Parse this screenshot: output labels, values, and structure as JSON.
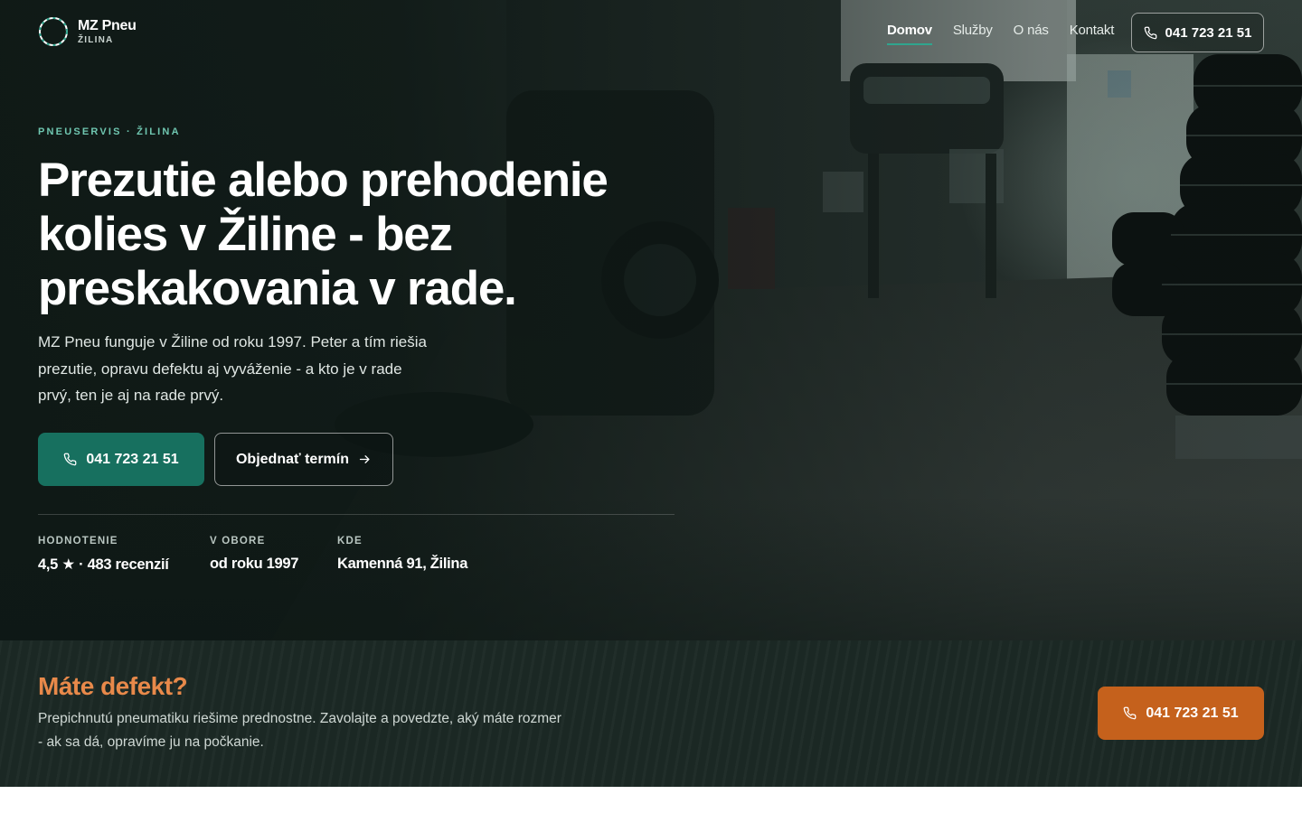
{
  "brand": {
    "name": "MZ Pneu",
    "city": "ŽILINA"
  },
  "nav": {
    "items": [
      {
        "label": "Domov",
        "active": true
      },
      {
        "label": "Služby",
        "active": false
      },
      {
        "label": "O nás",
        "active": false
      },
      {
        "label": "Kontakt",
        "active": false
      }
    ],
    "phone": "041 723 21 51"
  },
  "hero": {
    "eyebrow": "PNEUSERVIS · ŽILINA",
    "title": "Prezutie alebo prehodenie kolies v Žiline - bez preskakovania v rade.",
    "lead": "MZ Pneu funguje v Žiline od roku 1997. Peter a tím riešia prezutie, opravu defektu aj vyváženie - a kto je v rade prvý, ten je aj na rade prvý.",
    "cta_phone": "041 723 21 51",
    "cta_booking": "Objednať termín",
    "stats": [
      {
        "label": "HODNOTENIE",
        "value": "4,5 ★ · 483 recenzií"
      },
      {
        "label": "V OBORE",
        "value": "od roku 1997"
      },
      {
        "label": "KDE",
        "value": "Kamenná 91, Žilina"
      }
    ]
  },
  "defect": {
    "title": "Máte defekt?",
    "text": "Prepichnutú pneumatiku riešime prednostne. Zavolajte a povedzte, aký máte rozmer - ak sa dá, opravíme ju na počkanie.",
    "cta_phone": "041 723 21 51"
  },
  "colors": {
    "accent_teal": "#17705f",
    "accent_orange": "#c5611c",
    "defect_title": "#e8894a",
    "eyebrow": "#6fc6b0",
    "dark_bg": "#1b2824"
  },
  "icons": {
    "logo": "tire-ring-icon",
    "phone": "phone-icon",
    "arrow": "arrow-right-icon"
  }
}
